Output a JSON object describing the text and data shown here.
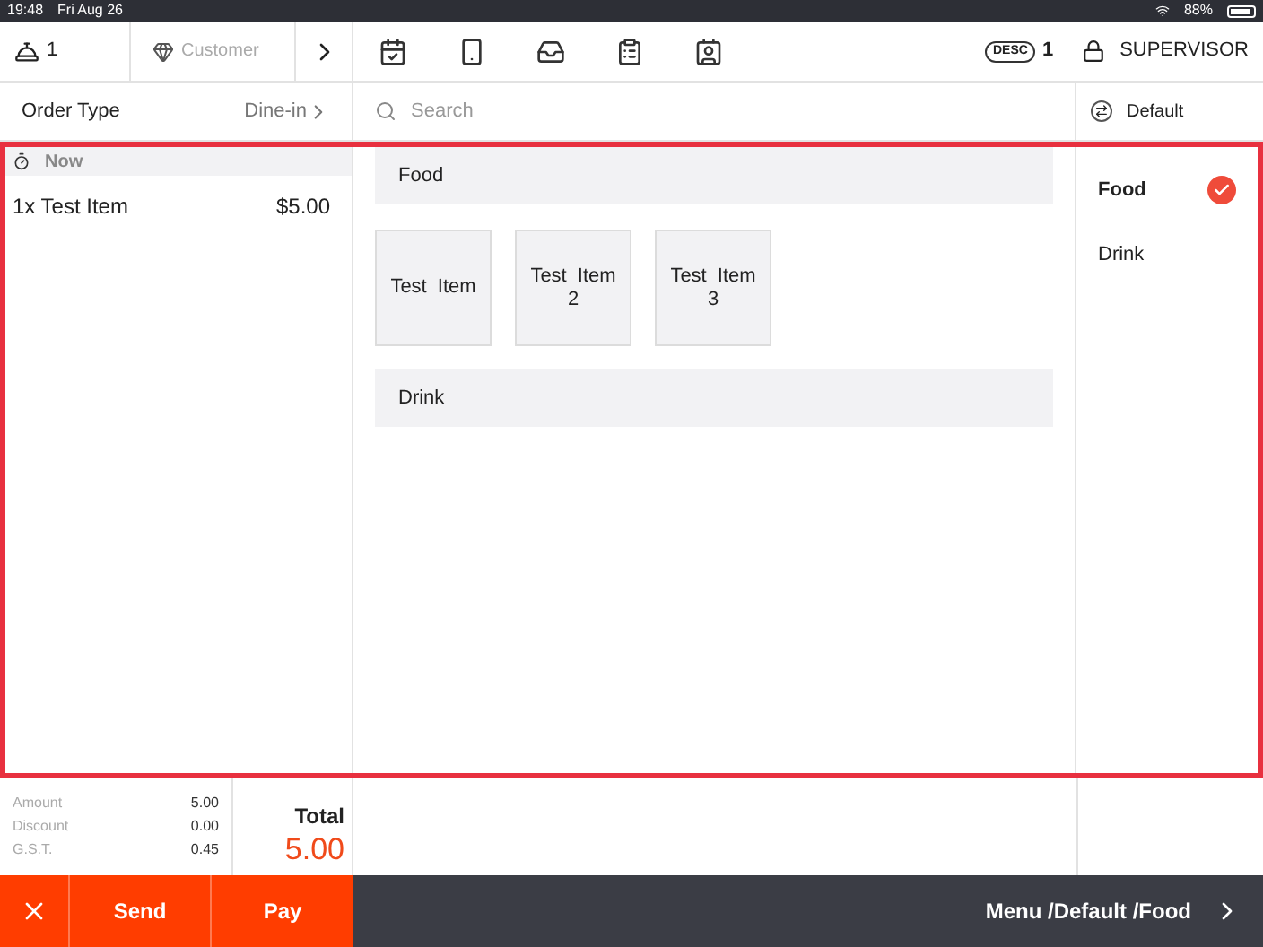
{
  "status_bar": {
    "time": "19:48",
    "date": "Fri Aug 26",
    "battery": "88%"
  },
  "top_bar": {
    "guests": "1",
    "customer_placeholder": "Customer",
    "sort_badge": "DESC",
    "sort_count": "1",
    "user": "SUPERVISOR"
  },
  "order_type": {
    "label": "Order Type",
    "value": "Dine-in"
  },
  "search": {
    "placeholder": "Search"
  },
  "menu_selector": {
    "label": "Default"
  },
  "order": {
    "course": "Now",
    "lines": [
      {
        "name": "1x Test Item",
        "price": "$5.00"
      }
    ]
  },
  "sections": [
    {
      "title": "Food",
      "items": [
        "Test Item",
        "Test Item 2",
        "Test Item 3"
      ]
    },
    {
      "title": "Drink"
    }
  ],
  "categories": [
    {
      "label": "Food",
      "selected": true
    },
    {
      "label": "Drink",
      "selected": false
    }
  ],
  "totals": {
    "rows": [
      {
        "label": "Amount",
        "value": "5.00"
      },
      {
        "label": "Discount",
        "value": "0.00"
      },
      {
        "label": "G.S.T.",
        "value": "0.45"
      }
    ],
    "total_label": "Total",
    "total_value": "5.00"
  },
  "actions": {
    "send": "Send",
    "pay": "Pay"
  },
  "breadcrumb": "Menu /Default /Food"
}
